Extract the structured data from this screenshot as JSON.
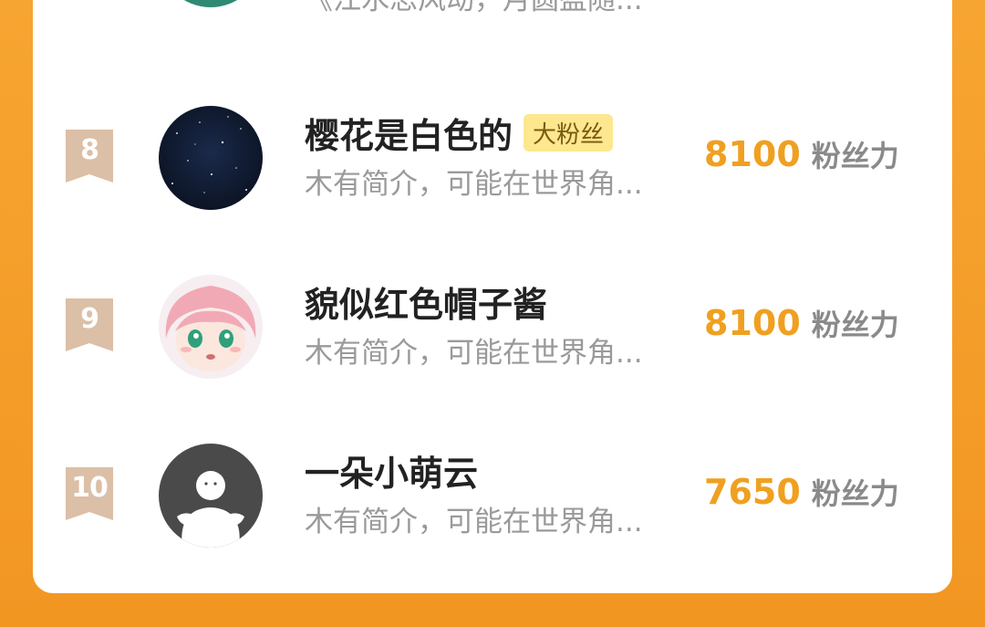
{
  "list": {
    "previous_row": {
      "bio": "《江水思风动，月圆盈随..."
    },
    "rows": [
      {
        "rank": "8",
        "name": "樱花是白色的",
        "badge": "大粉丝",
        "bio": "木有简介，可能在世界角...",
        "score": "8100",
        "score_unit": "粉丝力",
        "avatar_icon": "starry-night-avatar"
      },
      {
        "rank": "9",
        "name": "貌似红色帽子酱",
        "badge": "",
        "bio": "木有简介，可能在世界角...",
        "score": "8100",
        "score_unit": "粉丝力",
        "avatar_icon": "anime-girl-avatar"
      },
      {
        "rank": "10",
        "name": "一朵小萌云",
        "badge": "",
        "bio": "木有简介，可能在世界角...",
        "score": "7650",
        "score_unit": "粉丝力",
        "avatar_icon": "default-person-avatar"
      }
    ]
  },
  "colors": {
    "background": "#f29622",
    "score": "#f0a020",
    "rank_ribbon": "#d9b89c",
    "badge_bg": "#fde78f"
  }
}
